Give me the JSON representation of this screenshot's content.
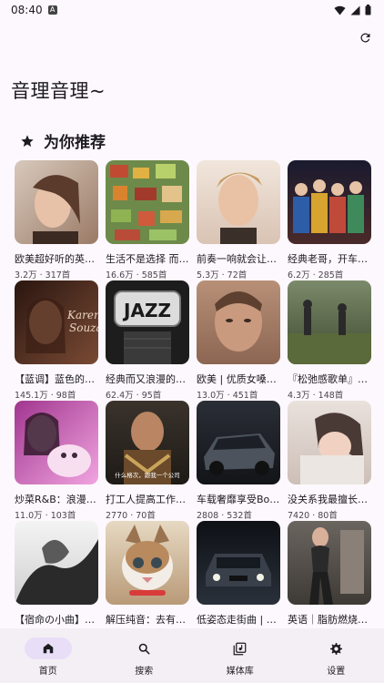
{
  "status": {
    "time": "08:40",
    "notification_icon": "A"
  },
  "page_title": "音理音理~",
  "section": {
    "title": "为你推荐",
    "icon": "star-icon"
  },
  "playlists": [
    {
      "title": "欧美超好听的英…",
      "meta": "3.2万 · 317首",
      "colors": [
        "#c9b8a8",
        "#6f4e3c"
      ]
    },
    {
      "title": "生活不是选择 而…",
      "meta": "16.6万 · 585首",
      "colors": [
        "#b5563c",
        "#4f7a3a"
      ]
    },
    {
      "title": "前奏一响就会让…",
      "meta": "5.3万 · 72首",
      "colors": [
        "#e7d6cc",
        "#8a6a55"
      ]
    },
    {
      "title": "经典老哥，开车…",
      "meta": "6.2万 · 285首",
      "colors": [
        "#c04a3a",
        "#2e5da8"
      ]
    },
    {
      "title": "【蓝调】蓝色的浪漫",
      "meta": "145.1万 · 98首",
      "colors": [
        "#3d2218",
        "#b57e5e"
      ]
    },
    {
      "title": "经典而又浪漫的…",
      "meta": "62.4万 · 95首",
      "colors": [
        "#1e1e1e",
        "#8f8f8f"
      ]
    },
    {
      "title": "欧美 | 优质女嗓一…",
      "meta": "13.0万 · 451首",
      "colors": [
        "#a88370",
        "#d3b59c"
      ]
    },
    {
      "title": "『松弛感歌单』…",
      "meta": "4.3万 · 148首",
      "colors": [
        "#4b5a3c",
        "#9aa57a"
      ]
    },
    {
      "title": "炒菜R&B：浪漫…",
      "meta": "11.0万 · 103首",
      "colors": [
        "#d86ac4",
        "#f3b0e6"
      ]
    },
    {
      "title": "打工人提高工作…",
      "meta": "2770 · 70首",
      "colors": [
        "#2f2b26",
        "#8a6e4f"
      ]
    },
    {
      "title": "车载奢靡享受Bos…",
      "meta": "2808 · 532首",
      "colors": [
        "#1c1f24",
        "#5a6068"
      ]
    },
    {
      "title": "没关系我最擅长…",
      "meta": "7420 · 80首",
      "colors": [
        "#d9c9c2",
        "#f1e8e2"
      ]
    },
    {
      "title": "【宿命の小曲】…",
      "meta": "",
      "colors": [
        "#e8e8e8",
        "#2a2a2a"
      ]
    },
    {
      "title": "解压纯音：去有…",
      "meta": "",
      "colors": [
        "#d9c6a8",
        "#8c6a48"
      ]
    },
    {
      "title": "低姿态走街曲 | ス…",
      "meta": "",
      "colors": [
        "#161a20",
        "#3c4452"
      ]
    },
    {
      "title": "英语｜脂肪燃烧…",
      "meta": "",
      "colors": [
        "#5c5753",
        "#b7aba0"
      ]
    }
  ],
  "overlay_text": {
    "jazz": "JAZZ",
    "karen": "Karen Souza",
    "subtitle": "什么格次，跟我一个公司"
  },
  "nav": [
    {
      "label": "首页",
      "icon": "home-icon",
      "active": true
    },
    {
      "label": "搜索",
      "icon": "search-icon",
      "active": false
    },
    {
      "label": "媒体库",
      "icon": "library-icon",
      "active": false
    },
    {
      "label": "设置",
      "icon": "settings-icon",
      "active": false
    }
  ]
}
